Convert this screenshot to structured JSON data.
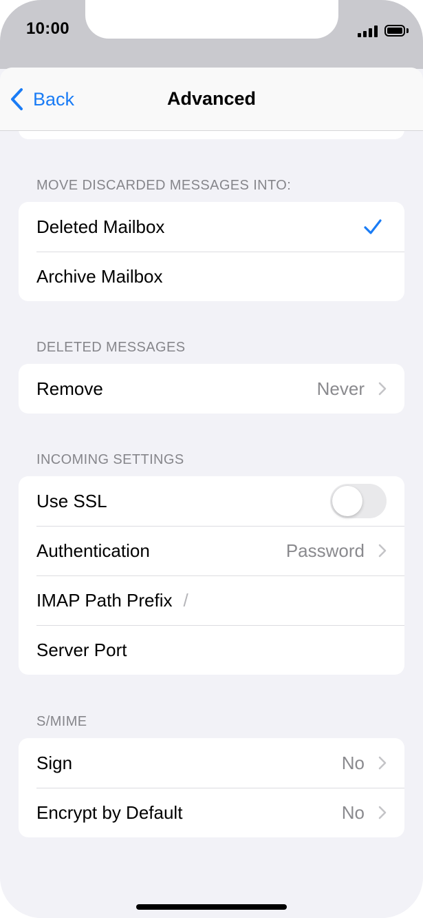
{
  "status_bar": {
    "time": "10:00"
  },
  "nav": {
    "back_label": "Back",
    "title": "Advanced"
  },
  "sections": {
    "discard": {
      "header": "MOVE DISCARDED MESSAGES INTO:",
      "deleted_mailbox": "Deleted Mailbox",
      "archive_mailbox": "Archive Mailbox",
      "selected": "Deleted Mailbox"
    },
    "deleted": {
      "header": "DELETED MESSAGES",
      "remove_label": "Remove",
      "remove_value": "Never"
    },
    "incoming": {
      "header": "INCOMING SETTINGS",
      "ssl_label": "Use SSL",
      "ssl_on": false,
      "auth_label": "Authentication",
      "auth_value": "Password",
      "imap_label": "IMAP Path Prefix",
      "imap_placeholder": "/",
      "port_label": "Server Port"
    },
    "smime": {
      "header": "S/MIME",
      "sign_label": "Sign",
      "sign_value": "No",
      "encrypt_label": "Encrypt by Default",
      "encrypt_value": "No"
    }
  },
  "colors": {
    "accent": "#1a7cf5",
    "background": "#f2f2f7",
    "secondary_text": "#8a8a8e"
  },
  "icons": [
    "back-chevron-icon",
    "checkmark-icon",
    "chevron-right-icon",
    "signal-icon",
    "battery-icon"
  ]
}
